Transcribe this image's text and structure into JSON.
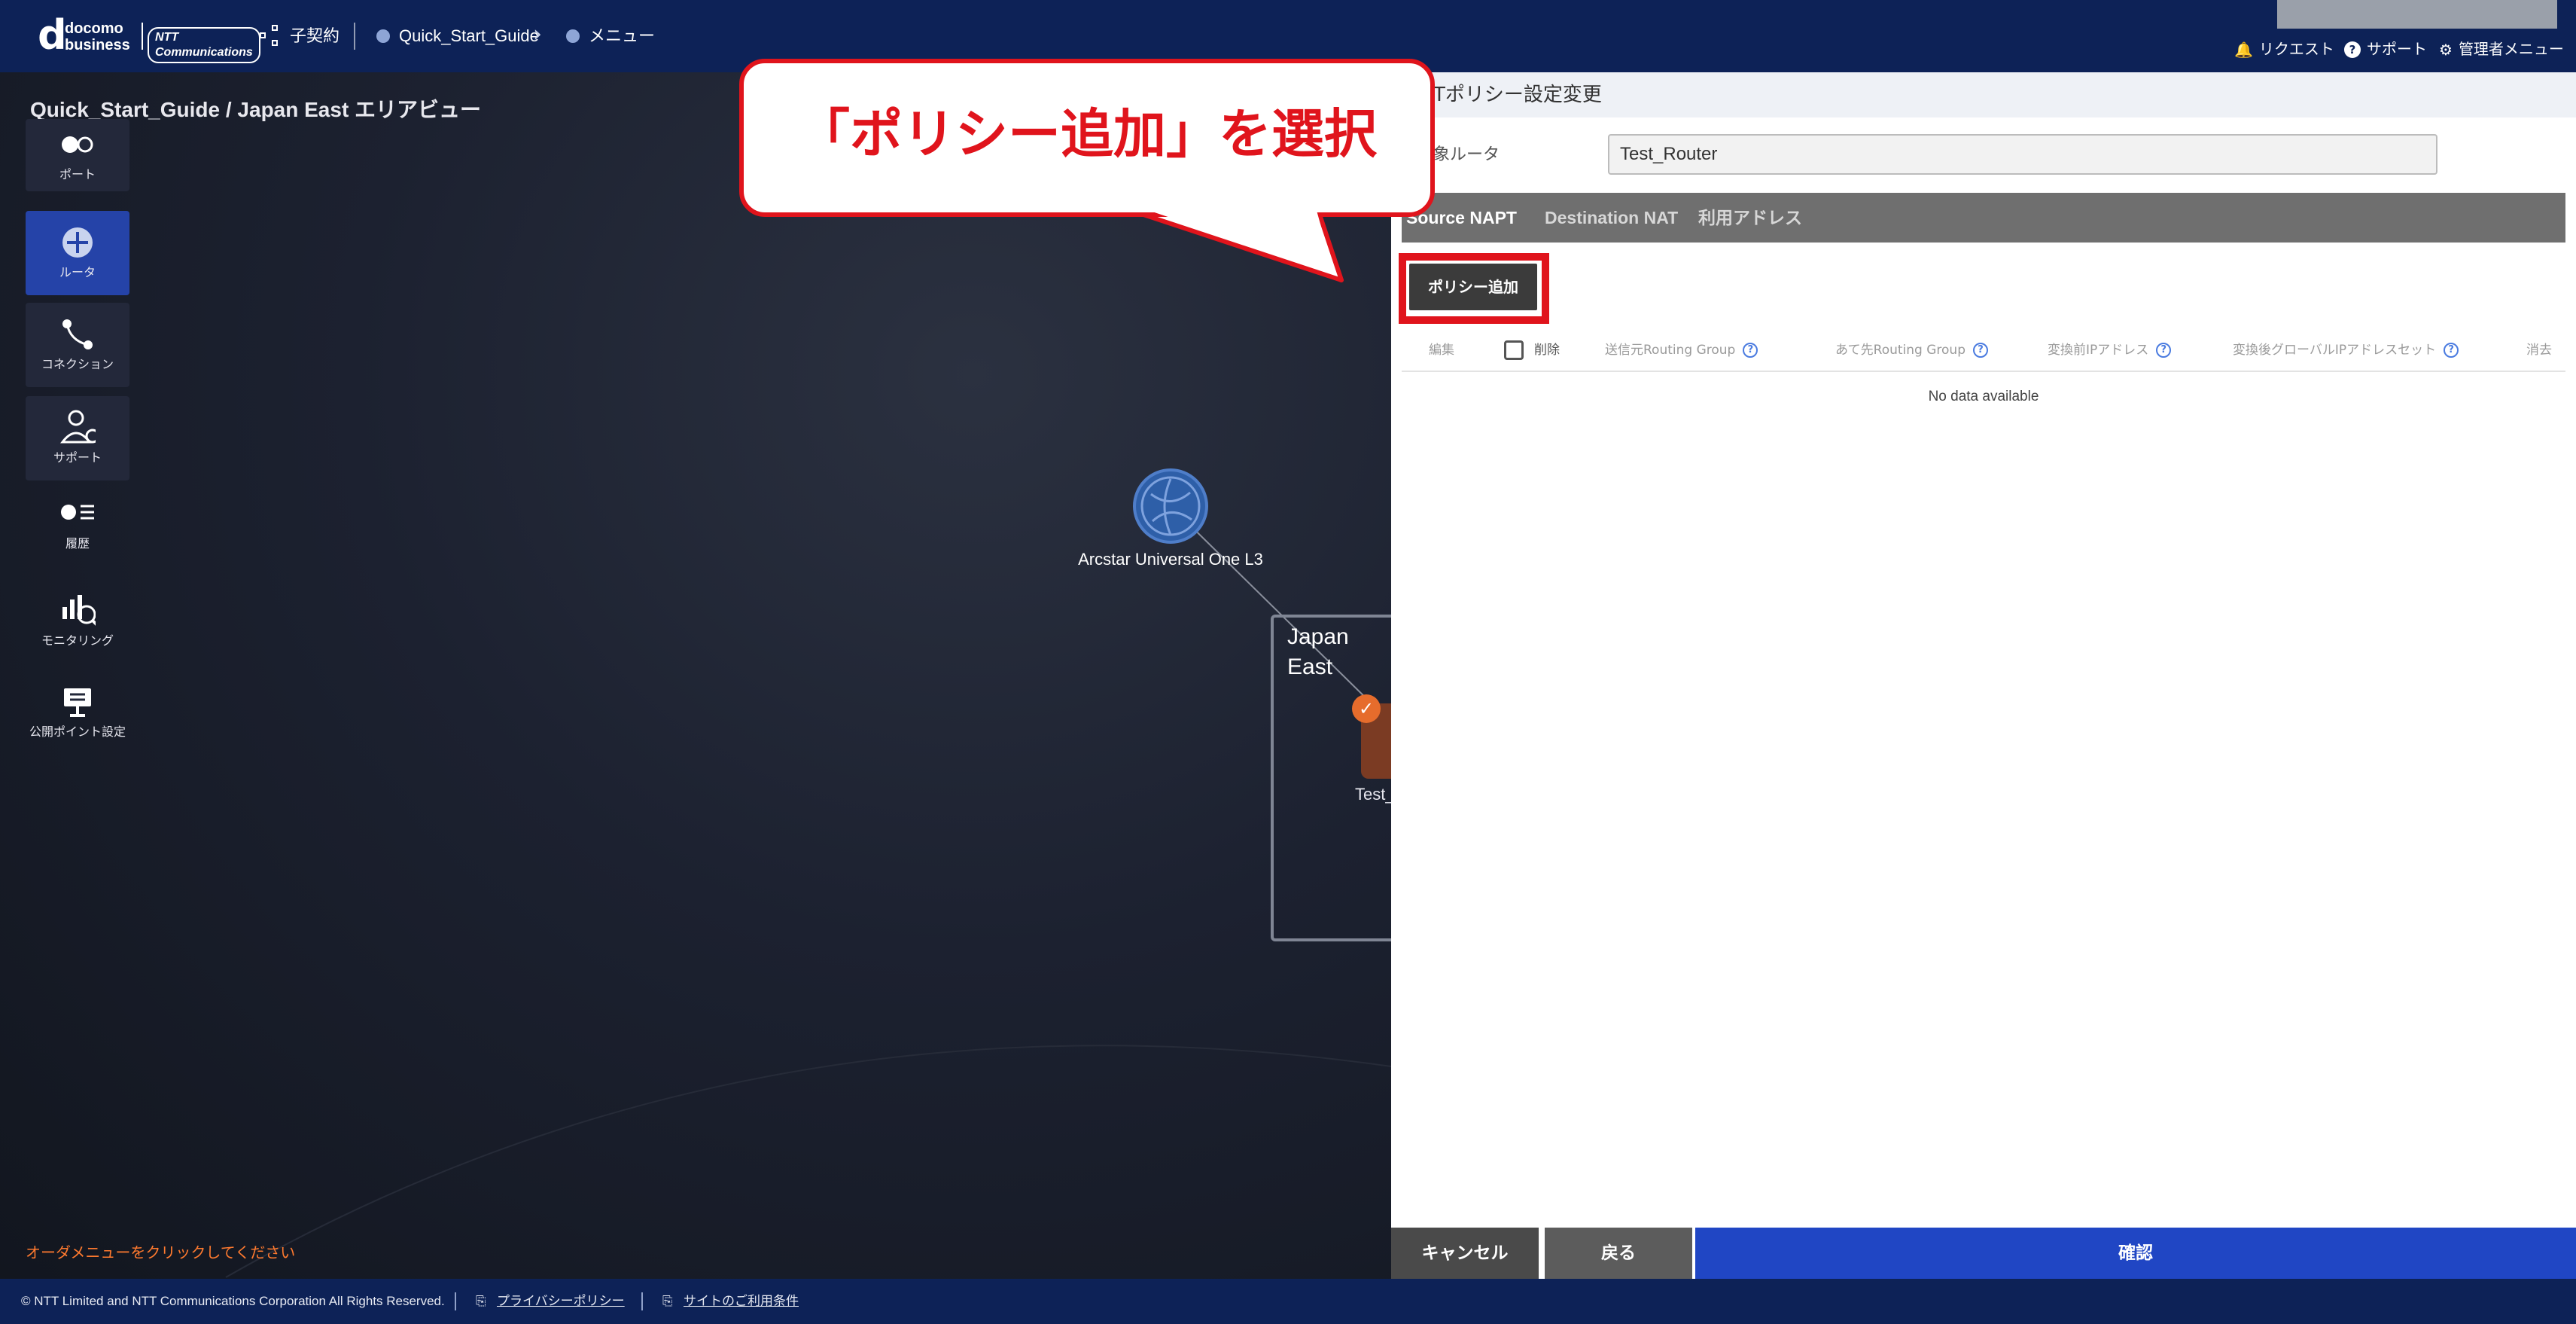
{
  "header": {
    "logo_letter": "d",
    "logo_line1": "docomo",
    "logo_line2": "business",
    "logo_partner": "NTT Communications",
    "contract": "子契約",
    "breadcrumb": [
      "Quick_Start_Guide",
      "メニュー"
    ],
    "right_links": [
      {
        "icon": "bell-icon",
        "glyph": "🔔",
        "label": "リクエスト"
      },
      {
        "icon": "help-icon",
        "glyph": "?",
        "label": "サポート"
      },
      {
        "icon": "gear-icon",
        "glyph": "⚙",
        "label": "管理者メニュー"
      }
    ]
  },
  "map": {
    "title": "Quick_Start_Guide / Japan East エリアビュー",
    "sidebar": [
      {
        "label": "ポート",
        "icon": "port-icon"
      },
      {
        "label": "ルータ",
        "icon": "router-icon",
        "active": true
      },
      {
        "label": "コネクション",
        "icon": "connection-icon"
      },
      {
        "label": "サポート",
        "icon": "support-icon"
      },
      {
        "label": "履歴",
        "icon": "history-icon"
      },
      {
        "label": "モニタリング",
        "icon": "monitoring-icon"
      },
      {
        "label": "公開ポイント設定",
        "icon": "public-point-icon"
      }
    ],
    "network_node": "Arcstar Universal One L3",
    "area": "Japan East",
    "router_label": "Test_",
    "order_hint": "オーダメニューをクリックしてください"
  },
  "callout": {
    "text": "「ポリシー追加」を選択"
  },
  "panel": {
    "title": "Tポリシー設定変更",
    "router_field_label": "象ルータ",
    "router_value": "Test_Router",
    "tabs": [
      "Source NAPT",
      "Destination NAT",
      "利用アドレス"
    ],
    "active_tab": "Source NAPT",
    "add_button": "ポリシー追加",
    "columns": {
      "edit": "編集",
      "delete": "削除",
      "src_group": "送信元Routing Group",
      "dst_group": "あて先Routing Group",
      "pre_ip": "変換前IPアドレス",
      "post_ip_set": "変換後グローバルIPアドレスセット",
      "erase": "消去"
    },
    "help_glyph": "?",
    "empty_text": "No data available",
    "buttons": {
      "cancel": "キャンセル",
      "back": "戻る",
      "confirm": "確認"
    }
  },
  "footer": {
    "copyright": "© NTT Limited and NTT Communications Corporation All Rights Reserved.",
    "privacy": "プライバシーポリシー",
    "terms": "サイトのご利用条件"
  },
  "colors": {
    "header_bg": "#0d2257",
    "accent_red": "#e0141c",
    "confirm_blue": "#2046c4",
    "active_sidebar": "#2543a8"
  }
}
